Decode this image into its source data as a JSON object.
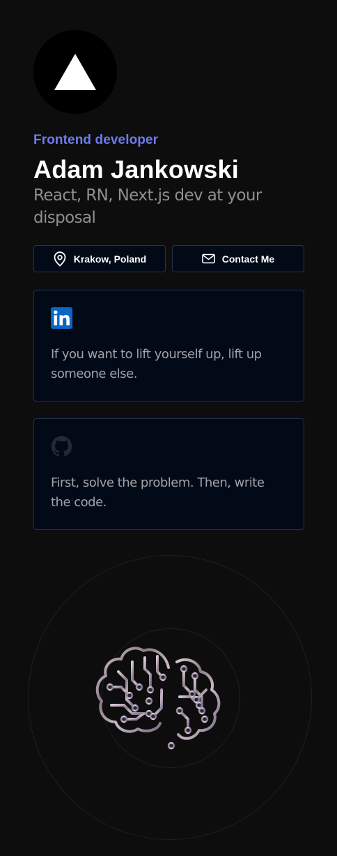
{
  "profile": {
    "role": "Frontend developer",
    "name": "Adam Jankowski",
    "tagline": "React, RN, Next.js dev at your disposal",
    "avatar_icon": "triangle-logo-icon"
  },
  "actions": {
    "location_label": "Krakow, Poland",
    "location_icon": "map-pin-icon",
    "contact_label": "Contact Me",
    "contact_icon": "mail-icon"
  },
  "quotes": [
    {
      "icon": "linkedin-icon",
      "text": "If you want to lift yourself up, lift up someone else."
    },
    {
      "icon": "github-icon",
      "text": "First, solve the problem. Then, write the code."
    }
  ],
  "illustration": {
    "icon": "circuit-brain-icon"
  },
  "colors": {
    "background": "#0d0d0d",
    "accent": "#6d7cf0",
    "card_background": "#020a18",
    "card_border": "#24304a",
    "linkedin_blue": "#0a66c2"
  }
}
